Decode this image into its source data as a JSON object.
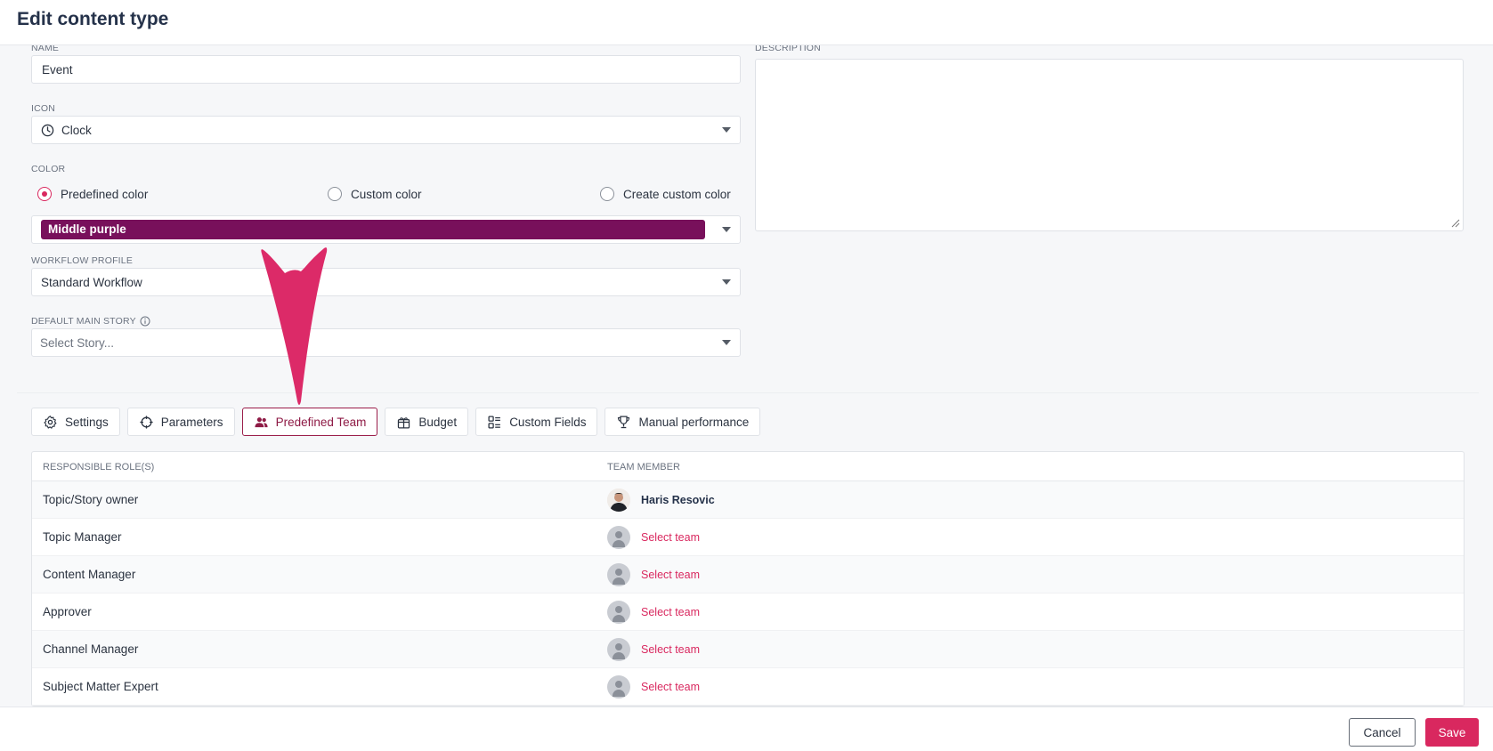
{
  "header": {
    "title": "Edit content type"
  },
  "form": {
    "name": {
      "label": "NAME",
      "value": "Event"
    },
    "description": {
      "label": "DESCRIPTION",
      "value": ""
    },
    "icon": {
      "label": "ICON",
      "value": "Clock",
      "icon": "clock-icon"
    },
    "color": {
      "label": "COLOR",
      "options": [
        "Predefined color",
        "Custom color",
        "Create custom color"
      ],
      "selected": "Predefined color",
      "selected_color_name": "Middle purple",
      "selected_color_hex": "#78105b"
    },
    "workflow": {
      "label": "WORKFLOW PROFILE",
      "value": "Standard Workflow"
    },
    "main_story": {
      "label": "DEFAULT MAIN STORY",
      "placeholder": "Select Story..."
    }
  },
  "tabs": [
    {
      "label": "Settings",
      "icon": "gear-icon"
    },
    {
      "label": "Parameters",
      "icon": "crosshair-icon"
    },
    {
      "label": "Predefined Team",
      "icon": "users-icon",
      "active": true
    },
    {
      "label": "Budget",
      "icon": "gift-icon"
    },
    {
      "label": "Custom Fields",
      "icon": "layout-icon"
    },
    {
      "label": "Manual performance",
      "icon": "trophy-icon"
    }
  ],
  "team_table": {
    "columns": [
      "RESPONSIBLE ROLE(S)",
      "TEAM MEMBER"
    ],
    "rows": [
      {
        "role": "Topic/Story owner",
        "member": "Haris Resovic"
      },
      {
        "role": "Topic Manager",
        "member": "Select team"
      },
      {
        "role": "Content Manager",
        "member": "Select team"
      },
      {
        "role": "Approver",
        "member": "Select team"
      },
      {
        "role": "Channel Manager",
        "member": "Select team"
      },
      {
        "role": "Subject Matter Expert",
        "member": "Select team"
      }
    ]
  },
  "footer": {
    "cancel_label": "Cancel",
    "save_label": "Save"
  },
  "colors": {
    "accent": "#d9285f",
    "active_tab": "#8e1a45",
    "arrow": "#dc2a68"
  }
}
